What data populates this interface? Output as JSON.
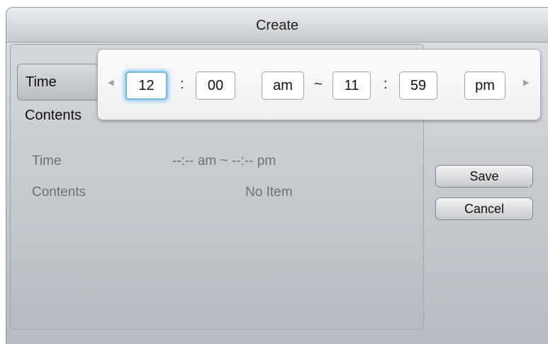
{
  "dialog": {
    "title": "Create",
    "menu": {
      "time_label": "Time",
      "contents_label": "Contents"
    },
    "details": {
      "time_label": "Time",
      "time_value": "--:-- am ~ --:-- pm",
      "contents_label": "Contents",
      "contents_value": "No Item"
    },
    "buttons": {
      "save": "Save",
      "cancel": "Cancel"
    }
  },
  "time_picker": {
    "start_hour": "12",
    "start_minute": "00",
    "start_period": "am",
    "range_separator": "~",
    "end_hour": "11",
    "end_minute": "59",
    "end_period": "pm",
    "colon": ":",
    "left_arrow_icon": "triangle-left",
    "right_arrow_icon": "triangle-right",
    "focus_color": "#79b8de"
  }
}
